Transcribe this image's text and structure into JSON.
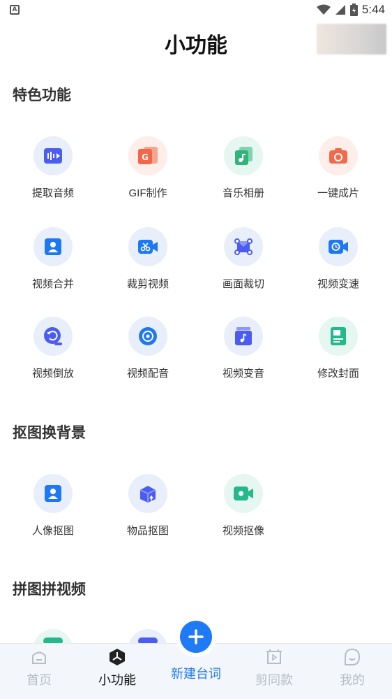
{
  "status": {
    "time": "5:44",
    "left_icon": "A"
  },
  "header": {
    "title": "小功能"
  },
  "sections": [
    {
      "title": "特色功能",
      "items": [
        {
          "label": "提取音频",
          "icon": "audio-extract-icon",
          "color": "#4a5df0"
        },
        {
          "label": "GIF制作",
          "icon": "gif-icon",
          "color": "#f2674a"
        },
        {
          "label": "音乐相册",
          "icon": "music-album-icon",
          "color": "#34b27b"
        },
        {
          "label": "一键成片",
          "icon": "camera-icon",
          "color": "#f26a4e"
        },
        {
          "label": "视频合并",
          "icon": "video-merge-icon",
          "color": "#1e78f2"
        },
        {
          "label": "裁剪视频",
          "icon": "video-cut-icon",
          "color": "#1e78f2"
        },
        {
          "label": "画面裁切",
          "icon": "crop-icon",
          "color": "#4a5df0"
        },
        {
          "label": "视频变速",
          "icon": "speed-icon",
          "color": "#1e78f2"
        },
        {
          "label": "视频倒放",
          "icon": "reverse-icon",
          "color": "#4a5df0"
        },
        {
          "label": "视频配音",
          "icon": "dubbing-icon",
          "color": "#1e78f2"
        },
        {
          "label": "视频变音",
          "icon": "voice-change-icon",
          "color": "#4a5df0"
        },
        {
          "label": "修改封面",
          "icon": "cover-icon",
          "color": "#25b88a"
        }
      ]
    },
    {
      "title": "抠图换背景",
      "items": [
        {
          "label": "人像抠图",
          "icon": "portrait-cutout-icon",
          "color": "#1e78f2"
        },
        {
          "label": "物品抠图",
          "icon": "object-cutout-icon",
          "color": "#4a5df0"
        },
        {
          "label": "视频抠像",
          "icon": "video-cutout-icon",
          "color": "#25b88a"
        }
      ]
    },
    {
      "title": "拼图拼视频",
      "items": []
    }
  ],
  "tabbar": {
    "tabs": [
      {
        "label": "首页",
        "icon": "home-icon"
      },
      {
        "label": "小功能",
        "icon": "tools-icon"
      },
      {
        "label": "剪同款",
        "icon": "template-icon"
      },
      {
        "label": "我的",
        "icon": "profile-icon"
      }
    ],
    "fab_label": "新建台词",
    "active_color": "#111111",
    "inactive_color": "#b7bcc6",
    "accent": "#1f7af5"
  }
}
